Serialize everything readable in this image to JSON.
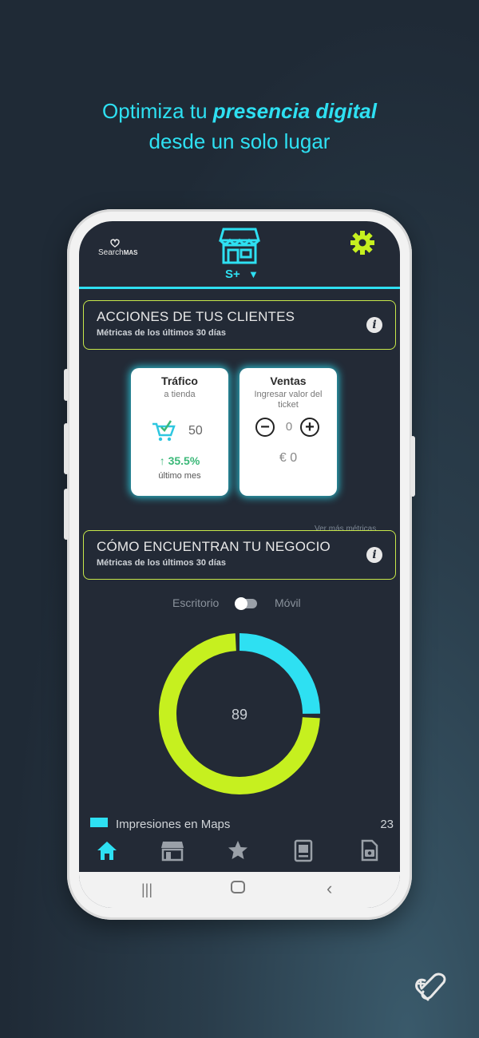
{
  "promo": {
    "line1_prefix": "Optimiza tu ",
    "line1_emphasis": "presencia digital",
    "line2": "desde un solo lugar"
  },
  "header": {
    "brand_prefix": "Search",
    "brand_suffix": "MAS",
    "store_selector": "S+",
    "icons": [
      "store-icon",
      "gear-icon",
      "chevron-down-icon"
    ]
  },
  "section_clients": {
    "title": "ACCIONES DE TUS CLIENTES",
    "subtitle": "Métricas de los últimos 30 días"
  },
  "card_traffic": {
    "title": "Tráfico",
    "subtitle": "a tienda",
    "value": "50",
    "change": "35.5%",
    "change_label": "último mes"
  },
  "card_sales": {
    "title": "Ventas",
    "subtitle": "Ingresar valor del ticket",
    "stepper_value": "0",
    "amount": "€ 0"
  },
  "more_metrics": "Ver más métricas",
  "section_business": {
    "title": "CÓMO ENCUENTRAN TU NEGOCIO",
    "subtitle": "Métricas de los últimos 30 días"
  },
  "device_toggle": {
    "left_label": "Escritorio",
    "right_label": "Móvil"
  },
  "donut": {
    "center_value": "89",
    "segments": [
      {
        "label": "Impresiones en Maps",
        "value": 23,
        "color": "#2ee0f2"
      },
      {
        "value": 66,
        "color": "#c6f01f"
      }
    ]
  },
  "legend": [
    {
      "label": "Impresiones en Maps",
      "value": "23"
    }
  ],
  "bottom_nav": [
    "home-icon",
    "store-icon",
    "star-icon",
    "document-icon",
    "photo-document-icon"
  ],
  "colors": {
    "accent_cyan": "#2ee0f2",
    "accent_lime": "#c6f01f",
    "screen_bg": "#232a36",
    "positive": "#3bb878"
  }
}
